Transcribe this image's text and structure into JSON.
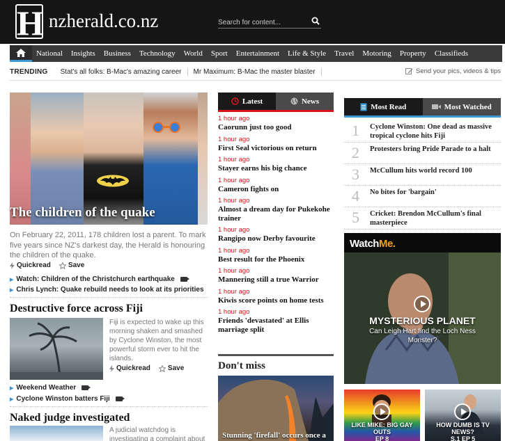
{
  "site": {
    "logo_letter": "H",
    "name": "nzherald.co.nz"
  },
  "search": {
    "placeholder": "Search for content..."
  },
  "nav": {
    "items": [
      "National",
      "Insights",
      "Business",
      "Technology",
      "World",
      "Sport",
      "Entertainment",
      "Life & Style",
      "Travel",
      "Motoring",
      "Property",
      "Classifieds"
    ]
  },
  "trending": {
    "label": "TRENDING",
    "items": [
      "Stat's all folks: B-Mac's amazing career",
      "Mr Maximum: B-Mac the master blaster"
    ],
    "send": "Send your pics, videos & tips"
  },
  "lead": {
    "caption": "The children of the quake",
    "summary": "On February 22, 2011, 178 children lost a parent. To mark five years since NZ's darkest day, the Herald is honouring the children of the quake.",
    "quickread": "Quickread",
    "save": "Save",
    "related": [
      "Watch: Children of the Christchurch earthquake",
      "Chris Lynch: Quake rebuild needs to look at its priorities"
    ]
  },
  "fiji": {
    "headline": "Destructive force across Fiji",
    "summary": "Fiji is expected to wake up this morning shaken and smashed by Cyclone Winston, the most powerful storm ever to hit the islands.",
    "quickread": "Quickread",
    "save": "Save",
    "related": [
      "Weekend Weather",
      "Cyclone Winston batters Fiji"
    ]
  },
  "judge": {
    "headline": "Naked judge investigated",
    "summary": "A judicial watchdog is investigating a complaint about"
  },
  "latest_tabs": {
    "latest": "Latest",
    "news": "News"
  },
  "latest": [
    {
      "time": "1 hour ago",
      "title": "Caorunn just too good"
    },
    {
      "time": "1 hour ago",
      "title": "First Seal victorious on return"
    },
    {
      "time": "1 hour ago",
      "title": "Stayer earns his big chance"
    },
    {
      "time": "1 hour ago",
      "title": "Cameron fights on"
    },
    {
      "time": "1 hour ago",
      "title": "Almost a dream day for Pukekohe trainer"
    },
    {
      "time": "1 hour ago",
      "title": "Rangipo now Derby favourite"
    },
    {
      "time": "1 hour ago",
      "title": "Best result for the Phoenix"
    },
    {
      "time": "1 hour ago",
      "title": "Mannering still a true Warrior"
    },
    {
      "time": "1 hour ago",
      "title": "Kiwis score points on home tests"
    },
    {
      "time": "1 hour ago",
      "title": "Friends 'devastated' at Ellis marriage split"
    }
  ],
  "dont_miss": {
    "heading": "Don't miss",
    "caption": "Stunning 'firefall' occurs once a"
  },
  "most_tabs": {
    "read": "Most Read",
    "watched": "Most Watched"
  },
  "most_read": [
    {
      "num": "1",
      "title": "Cyclone Winston: One dead as massive tropical cyclone hits Fiji"
    },
    {
      "num": "2",
      "title": "Protesters bring Pride Parade to a halt"
    },
    {
      "num": "3",
      "title": "McCullum hits world record 100"
    },
    {
      "num": "4",
      "title": "No bites for 'bargain'"
    },
    {
      "num": "5",
      "title": "Cricket: Brendon McCullum's final masterpiece"
    }
  ],
  "watchme": {
    "logo_a": "Watch",
    "logo_b": "Me.",
    "title": "MYSTERIOUS PLANET",
    "subtitle": "Can Leigh Hart find the Loch Ness Monster?"
  },
  "thumbs": [
    {
      "title": "LIKE MIKE: BIG GAY OUTS",
      "ep": "EP 8"
    },
    {
      "title": "HOW DUMB IS TV NEWS?",
      "ep": "S.1 EP 5"
    }
  ],
  "colors": {
    "accent_red": "#d6151b",
    "accent_blue": "#3a97d4",
    "masthead": "#151515",
    "nav": "#3a3a3a"
  }
}
